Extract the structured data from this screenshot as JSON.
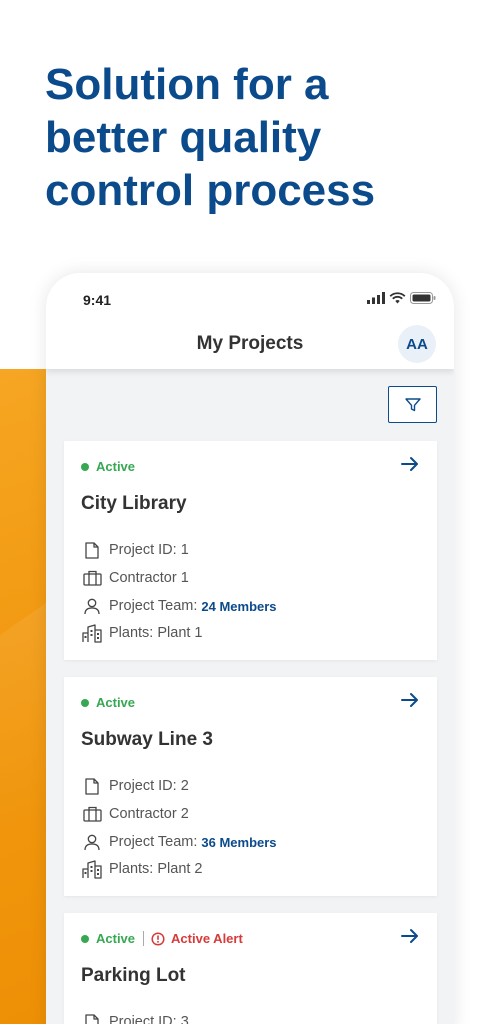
{
  "headline": {
    "line1": "Solution for a",
    "line2": "better quality",
    "line3": "control process"
  },
  "status_bar": {
    "time": "9:41"
  },
  "header": {
    "title": "My Projects",
    "avatar_initials": "AA"
  },
  "filter": {
    "icon": "filter-icon"
  },
  "colors": {
    "brand": "#0b4a8b",
    "accent": "#f29a12",
    "active": "#36a852",
    "alert": "#d63a3a"
  },
  "labels": {
    "project_id": "Project ID:",
    "contractor": "Contractor",
    "team": "Project Team:",
    "plants": "Plants:"
  },
  "projects": [
    {
      "status": "Active",
      "alert": "",
      "name": "City Library",
      "project_id": "Project ID: 1",
      "contractor": "Contractor 1",
      "team_label": "Project Team:",
      "members": "24 Members",
      "plants": "Plants: Plant 1"
    },
    {
      "status": "Active",
      "alert": "",
      "name": "Subway Line 3",
      "project_id": "Project ID: 2",
      "contractor": "Contractor 2",
      "team_label": "Project Team:",
      "members": "36 Members",
      "plants": "Plants: Plant 2"
    },
    {
      "status": "Active",
      "alert": "Active Alert",
      "name": "Parking Lot",
      "project_id": "Project ID: 3"
    }
  ]
}
